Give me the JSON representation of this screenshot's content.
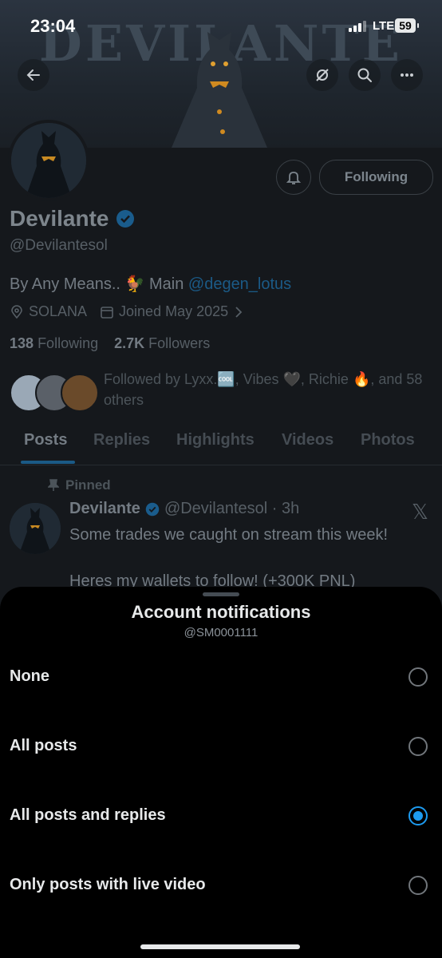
{
  "status_bar": {
    "time": "23:04",
    "network": "LTE",
    "battery": "59"
  },
  "banner": {
    "title": "DEVILANTE"
  },
  "header": {
    "back_icon": "arrow-left-icon",
    "grok_icon": "grok-icon",
    "search_icon": "search-icon",
    "more_icon": "more-horizontal-icon"
  },
  "profile": {
    "name": "Devilante",
    "handle": "@Devilantesol",
    "bio_prefix": "By Any Means.. 🐓 Main ",
    "bio_link": "@degen_lotus",
    "location": "SOLANA",
    "joined": "Joined May 2025",
    "following_count": "138",
    "following_label": "Following",
    "followers_count": "2.7K",
    "followers_label": "Followers",
    "followed_by": "Followed by Lyxx.🆒, Vibes 🖤, Richie 🔥, and 58 others",
    "follow_button": "Following"
  },
  "tabs": [
    "Posts",
    "Replies",
    "Highlights",
    "Videos",
    "Photos"
  ],
  "active_tab": "Posts",
  "pinned_post": {
    "pinned_label": "Pinned",
    "author": "Devilante",
    "handle_time": "@Devilantesol · 3h",
    "line1": "Some trades we caught on stream this week!",
    "line2": "Heres my wallets to follow! (+300K PNL)"
  },
  "sheet": {
    "title": "Account notifications",
    "subtitle": "@SM0001111",
    "options": [
      "None",
      "All posts",
      "All posts and replies",
      "Only posts with live video"
    ],
    "selected": "All posts and replies"
  },
  "colors": {
    "accent": "#1d9bf0",
    "verified": "#1d9bf0",
    "background": "#000000"
  }
}
